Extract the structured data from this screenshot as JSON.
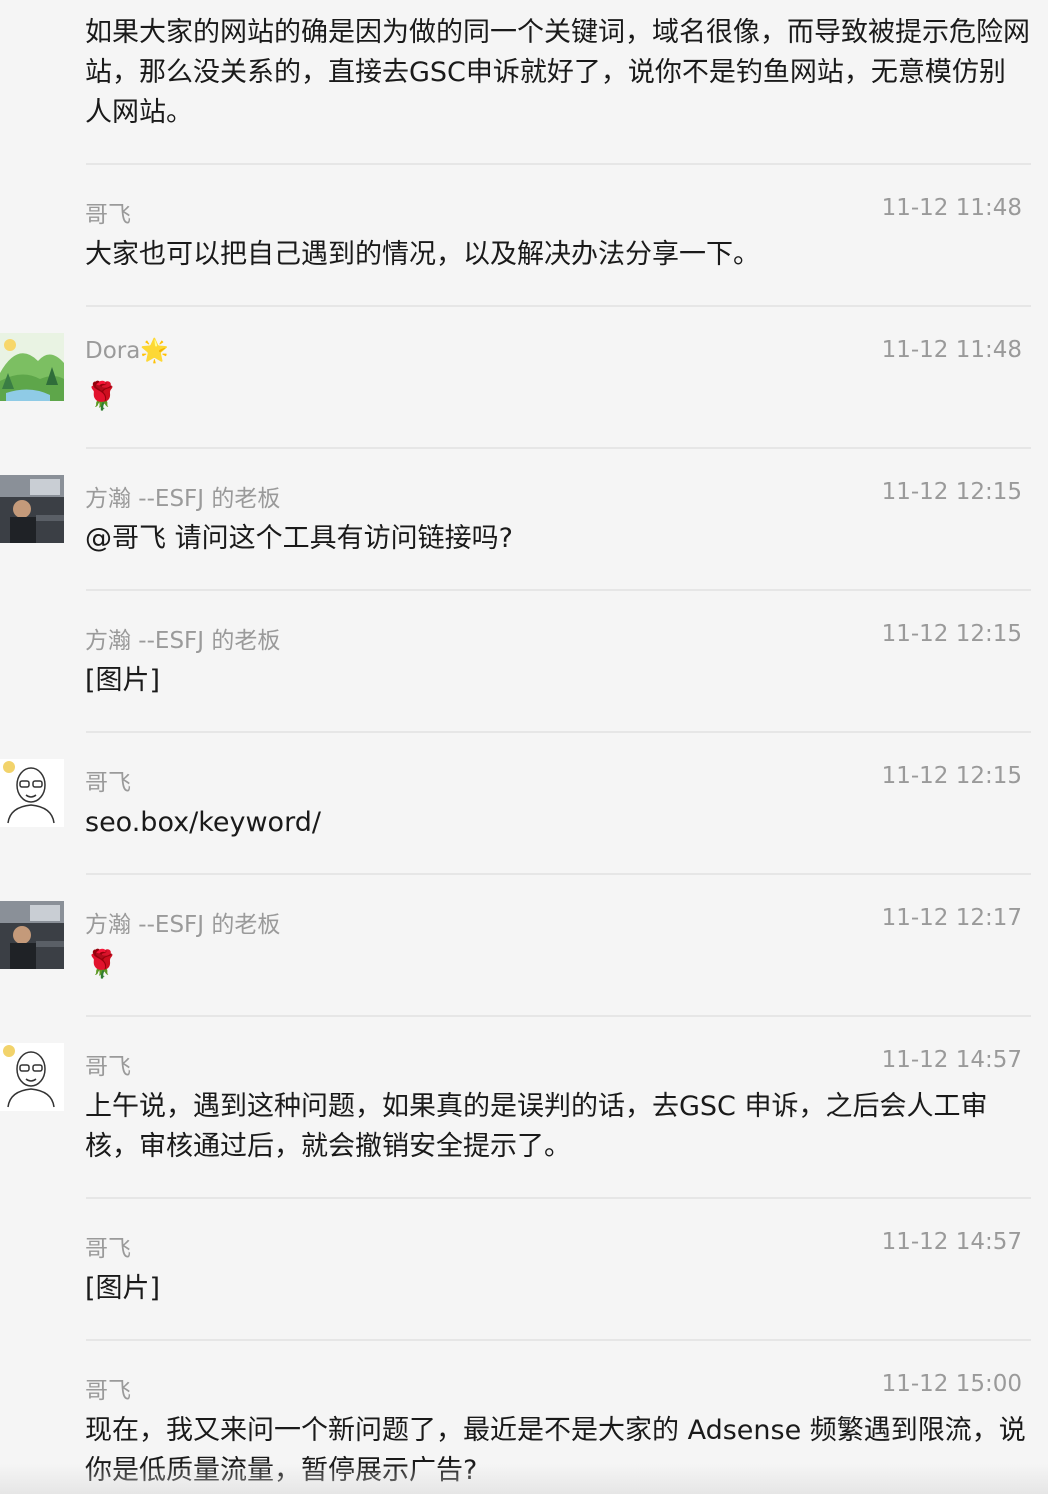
{
  "messages": [
    {
      "sender": "",
      "time": "",
      "text": "如果大家的网站的确是因为做的同一个关键词，域名很像，而导致被提示危险网站，那么没关系的，直接去GSC申诉就好了，说你不是钓鱼网站，无意模仿别人网站。",
      "avatar": "none"
    },
    {
      "sender": "哥飞",
      "time": "11-12 11:48",
      "text": "大家也可以把自己遇到的情况，以及解决办法分享一下。",
      "avatar": "none"
    },
    {
      "sender": "Dora",
      "sender_emoji": "🌟",
      "time": "11-12 11:48",
      "text": "🌹",
      "avatar": "landscape-avatar"
    },
    {
      "sender": "方瀚 --ESFJ 的老板",
      "time": "11-12 12:15",
      "text": "@哥飞 请问这个工具有访问链接吗?",
      "avatar": "car-driver-avatar"
    },
    {
      "sender": "方瀚 --ESFJ 的老板",
      "time": "11-12 12:15",
      "text": "[图片]",
      "avatar": "none"
    },
    {
      "sender": "哥飞",
      "time": "11-12 12:15",
      "text": "seo.box/keyword/",
      "avatar": "bald-glasses-avatar"
    },
    {
      "sender": "方瀚 --ESFJ 的老板",
      "time": "11-12 12:17",
      "text": "🌹",
      "avatar": "car-driver-avatar"
    },
    {
      "sender": "哥飞",
      "time": "11-12 14:57",
      "text": "上午说，遇到这种问题，如果真的是误判的话，去GSC 申诉，之后会人工审核，审核通过后，就会撤销安全提示了。",
      "avatar": "bald-glasses-avatar"
    },
    {
      "sender": "哥飞",
      "time": "11-12 14:57",
      "text": "[图片]",
      "avatar": "none"
    },
    {
      "sender": "哥飞",
      "time": "11-12 15:00",
      "text": "现在，我又来问一个新问题了，最近是不是大家的 Adsense 频繁遇到限流，说你是低质量流量，暂停展示广告?",
      "avatar": "none"
    }
  ]
}
